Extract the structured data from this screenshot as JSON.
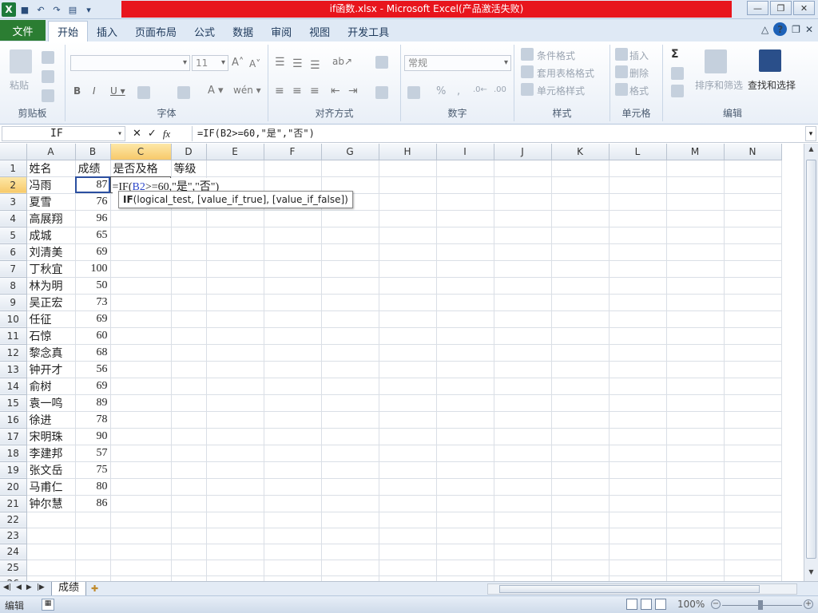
{
  "window": {
    "title": "if函数.xlsx - Microsoft Excel(产品激活失败)",
    "app_icon": "X"
  },
  "ribbon_tabs": [
    "文件",
    "开始",
    "插入",
    "页面布局",
    "公式",
    "数据",
    "审阅",
    "视图",
    "开发工具"
  ],
  "ribbon": {
    "clipboard": {
      "label": "剪贴板",
      "paste": "粘贴"
    },
    "font": {
      "label": "字体",
      "font_size": "11"
    },
    "alignment": {
      "label": "对齐方式"
    },
    "number": {
      "label": "数字",
      "format": "常规"
    },
    "styles": {
      "label": "样式",
      "conditional": "条件格式",
      "table": "套用表格格式",
      "cell": "单元格样式"
    },
    "cells": {
      "label": "单元格",
      "insert": "插入",
      "delete": "删除",
      "format": "格式"
    },
    "editing": {
      "label": "编辑",
      "sort": "排序和筛选",
      "find": "查找和选择",
      "sum": "Σ"
    }
  },
  "formula_bar": {
    "name_box": "IF",
    "fx": "fx",
    "formula": "=IF(B2>=60,\"是\",\"否\")"
  },
  "columns": [
    "A",
    "B",
    "C",
    "D",
    "E",
    "F",
    "G",
    "H",
    "I",
    "J",
    "K",
    "L",
    "M",
    "N"
  ],
  "rows": [
    [
      "姓名",
      "成绩",
      "是否及格",
      "等级"
    ],
    [
      "冯雨",
      "87",
      "",
      ""
    ],
    [
      "夏雪",
      "76",
      "",
      ""
    ],
    [
      "高展翔",
      "96",
      "",
      ""
    ],
    [
      "成城",
      "65",
      "",
      ""
    ],
    [
      "刘清美",
      "69",
      "",
      ""
    ],
    [
      "丁秋宜",
      "100",
      "",
      ""
    ],
    [
      "林为明",
      "50",
      "",
      ""
    ],
    [
      "吴正宏",
      "73",
      "",
      ""
    ],
    [
      "任征",
      "69",
      "",
      ""
    ],
    [
      "石惊",
      "60",
      "",
      ""
    ],
    [
      "黎念真",
      "68",
      "",
      ""
    ],
    [
      "钟开才",
      "56",
      "",
      ""
    ],
    [
      "俞树",
      "69",
      "",
      ""
    ],
    [
      "袁一鸣",
      "89",
      "",
      ""
    ],
    [
      "徐进",
      "78",
      "",
      ""
    ],
    [
      "宋明珠",
      "90",
      "",
      ""
    ],
    [
      "李建邦",
      "57",
      "",
      ""
    ],
    [
      "张文岳",
      "75",
      "",
      ""
    ],
    [
      "马甫仁",
      "80",
      "",
      ""
    ],
    [
      "钟尔慧",
      "86",
      "",
      ""
    ],
    [
      "",
      "",
      "",
      ""
    ],
    [
      "",
      "",
      "",
      ""
    ],
    [
      "",
      "",
      "",
      ""
    ],
    [
      "",
      "",
      "",
      ""
    ],
    [
      "",
      "",
      "",
      ""
    ],
    [
      "",
      "",
      "",
      ""
    ]
  ],
  "editing_cell": {
    "prefix": "=IF(",
    "ref": "B2",
    "suffix": ">=60,\"是\",\"否\")"
  },
  "tooltip": {
    "func": "IF",
    "args": "(logical_test, [value_if_true], [value_if_false])"
  },
  "sheet_tabs": [
    "成绩"
  ],
  "status": {
    "mode": "编辑",
    "zoom": "100%"
  }
}
